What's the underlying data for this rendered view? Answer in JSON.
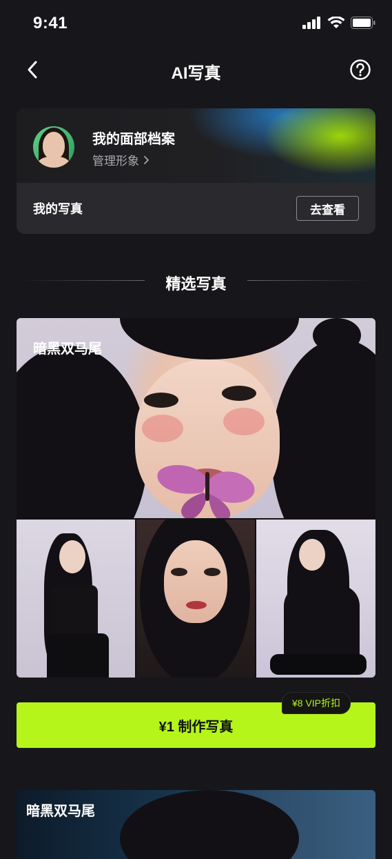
{
  "status_bar": {
    "time": "9:41"
  },
  "nav": {
    "title": "AI写真"
  },
  "profile": {
    "title": "我的面部档案",
    "manage_label": "管理形象",
    "my_photos_label": "我的写真",
    "view_button": "去查看"
  },
  "section": {
    "title": "精选写真"
  },
  "style_card": {
    "title": "暗黑双马尾",
    "cta_label": "¥1 制作写真",
    "vip_badge": "¥8 VIP折扣"
  },
  "next_card": {
    "title": "暗黑双马尾"
  },
  "colors": {
    "accent": "#b5f51a",
    "background": "#17161a"
  }
}
